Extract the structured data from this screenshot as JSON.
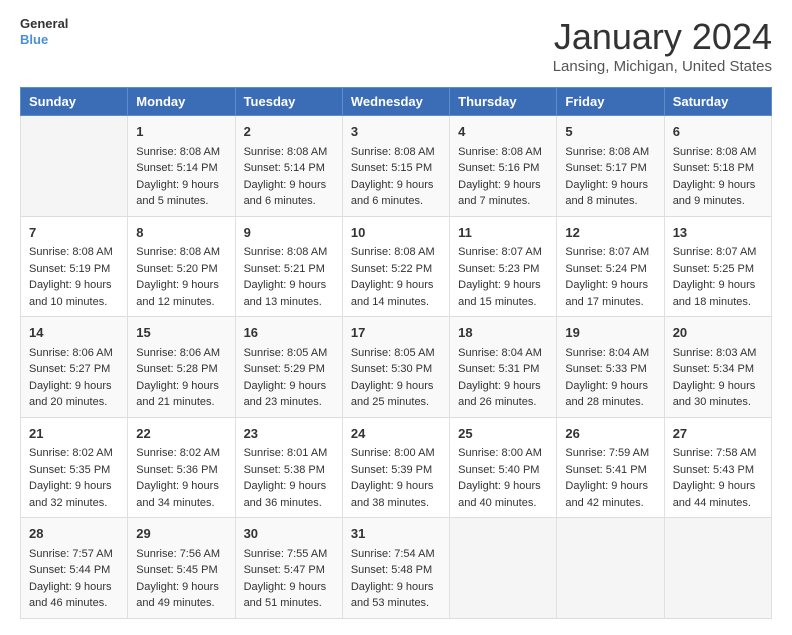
{
  "header": {
    "logo_line1": "General",
    "logo_line2": "Blue",
    "title": "January 2024",
    "subtitle": "Lansing, Michigan, United States"
  },
  "days_of_week": [
    "Sunday",
    "Monday",
    "Tuesday",
    "Wednesday",
    "Thursday",
    "Friday",
    "Saturday"
  ],
  "weeks": [
    [
      {
        "day": "",
        "sunrise": "",
        "sunset": "",
        "daylight": ""
      },
      {
        "day": "1",
        "sunrise": "8:08 AM",
        "sunset": "5:14 PM",
        "daylight": "9 hours and 5 minutes."
      },
      {
        "day": "2",
        "sunrise": "8:08 AM",
        "sunset": "5:14 PM",
        "daylight": "9 hours and 6 minutes."
      },
      {
        "day": "3",
        "sunrise": "8:08 AM",
        "sunset": "5:15 PM",
        "daylight": "9 hours and 6 minutes."
      },
      {
        "day": "4",
        "sunrise": "8:08 AM",
        "sunset": "5:16 PM",
        "daylight": "9 hours and 7 minutes."
      },
      {
        "day": "5",
        "sunrise": "8:08 AM",
        "sunset": "5:17 PM",
        "daylight": "9 hours and 8 minutes."
      },
      {
        "day": "6",
        "sunrise": "8:08 AM",
        "sunset": "5:18 PM",
        "daylight": "9 hours and 9 minutes."
      }
    ],
    [
      {
        "day": "7",
        "sunrise": "8:08 AM",
        "sunset": "5:19 PM",
        "daylight": "9 hours and 10 minutes."
      },
      {
        "day": "8",
        "sunrise": "8:08 AM",
        "sunset": "5:20 PM",
        "daylight": "9 hours and 12 minutes."
      },
      {
        "day": "9",
        "sunrise": "8:08 AM",
        "sunset": "5:21 PM",
        "daylight": "9 hours and 13 minutes."
      },
      {
        "day": "10",
        "sunrise": "8:08 AM",
        "sunset": "5:22 PM",
        "daylight": "9 hours and 14 minutes."
      },
      {
        "day": "11",
        "sunrise": "8:07 AM",
        "sunset": "5:23 PM",
        "daylight": "9 hours and 15 minutes."
      },
      {
        "day": "12",
        "sunrise": "8:07 AM",
        "sunset": "5:24 PM",
        "daylight": "9 hours and 17 minutes."
      },
      {
        "day": "13",
        "sunrise": "8:07 AM",
        "sunset": "5:25 PM",
        "daylight": "9 hours and 18 minutes."
      }
    ],
    [
      {
        "day": "14",
        "sunrise": "8:06 AM",
        "sunset": "5:27 PM",
        "daylight": "9 hours and 20 minutes."
      },
      {
        "day": "15",
        "sunrise": "8:06 AM",
        "sunset": "5:28 PM",
        "daylight": "9 hours and 21 minutes."
      },
      {
        "day": "16",
        "sunrise": "8:05 AM",
        "sunset": "5:29 PM",
        "daylight": "9 hours and 23 minutes."
      },
      {
        "day": "17",
        "sunrise": "8:05 AM",
        "sunset": "5:30 PM",
        "daylight": "9 hours and 25 minutes."
      },
      {
        "day": "18",
        "sunrise": "8:04 AM",
        "sunset": "5:31 PM",
        "daylight": "9 hours and 26 minutes."
      },
      {
        "day": "19",
        "sunrise": "8:04 AM",
        "sunset": "5:33 PM",
        "daylight": "9 hours and 28 minutes."
      },
      {
        "day": "20",
        "sunrise": "8:03 AM",
        "sunset": "5:34 PM",
        "daylight": "9 hours and 30 minutes."
      }
    ],
    [
      {
        "day": "21",
        "sunrise": "8:02 AM",
        "sunset": "5:35 PM",
        "daylight": "9 hours and 32 minutes."
      },
      {
        "day": "22",
        "sunrise": "8:02 AM",
        "sunset": "5:36 PM",
        "daylight": "9 hours and 34 minutes."
      },
      {
        "day": "23",
        "sunrise": "8:01 AM",
        "sunset": "5:38 PM",
        "daylight": "9 hours and 36 minutes."
      },
      {
        "day": "24",
        "sunrise": "8:00 AM",
        "sunset": "5:39 PM",
        "daylight": "9 hours and 38 minutes."
      },
      {
        "day": "25",
        "sunrise": "8:00 AM",
        "sunset": "5:40 PM",
        "daylight": "9 hours and 40 minutes."
      },
      {
        "day": "26",
        "sunrise": "7:59 AM",
        "sunset": "5:41 PM",
        "daylight": "9 hours and 42 minutes."
      },
      {
        "day": "27",
        "sunrise": "7:58 AM",
        "sunset": "5:43 PM",
        "daylight": "9 hours and 44 minutes."
      }
    ],
    [
      {
        "day": "28",
        "sunrise": "7:57 AM",
        "sunset": "5:44 PM",
        "daylight": "9 hours and 46 minutes."
      },
      {
        "day": "29",
        "sunrise": "7:56 AM",
        "sunset": "5:45 PM",
        "daylight": "9 hours and 49 minutes."
      },
      {
        "day": "30",
        "sunrise": "7:55 AM",
        "sunset": "5:47 PM",
        "daylight": "9 hours and 51 minutes."
      },
      {
        "day": "31",
        "sunrise": "7:54 AM",
        "sunset": "5:48 PM",
        "daylight": "9 hours and 53 minutes."
      },
      {
        "day": "",
        "sunrise": "",
        "sunset": "",
        "daylight": ""
      },
      {
        "day": "",
        "sunrise": "",
        "sunset": "",
        "daylight": ""
      },
      {
        "day": "",
        "sunrise": "",
        "sunset": "",
        "daylight": ""
      }
    ]
  ],
  "labels": {
    "sunrise_prefix": "Sunrise: ",
    "sunset_prefix": "Sunset: ",
    "daylight_prefix": "Daylight: "
  }
}
